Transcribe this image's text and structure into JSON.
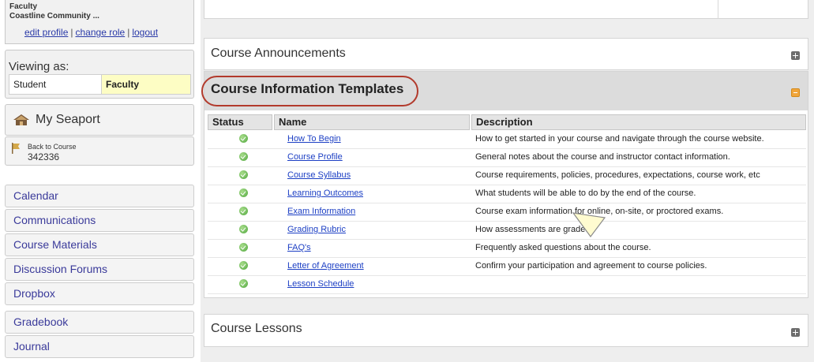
{
  "sidebar": {
    "user": {
      "role": "Faculty",
      "school": "Coastline Community ...",
      "links": [
        "edit profile",
        "change role",
        "logout"
      ],
      "separator": "|"
    },
    "viewing": {
      "label": "Viewing as:",
      "student": "Student",
      "faculty": "Faculty",
      "selected": "Faculty"
    },
    "my_seaport": {
      "label": "My Seaport",
      "icon": "home-icon"
    },
    "back_to_course": {
      "label": "Back to Course",
      "code": "342336",
      "icon": "flag-icon"
    },
    "nav": [
      "Calendar",
      "Communications",
      "Course Materials",
      "Discussion Forums",
      "Dropbox",
      "Gradebook",
      "Journal"
    ]
  },
  "main": {
    "announcements": {
      "title": "Course Announcements",
      "icon": "expand-plus-icon"
    },
    "templates": {
      "title": "Course Information Templates",
      "icon": "collapse-minus-icon",
      "highlight_color": "#b23a2c",
      "columns": {
        "status": "Status",
        "name": "Name",
        "description": "Description"
      },
      "rows": [
        {
          "status": "check-icon",
          "name": "How To Begin",
          "description": "How to get started in your course and navigate through the course website."
        },
        {
          "status": "check-icon",
          "name": "Course Profile",
          "description": "General notes about the course and instructor contact information."
        },
        {
          "status": "check-icon",
          "name": "Course Syllabus",
          "description": "Course requirements, policies, procedures, expectations, course work, etc"
        },
        {
          "status": "check-icon",
          "name": "Learning Outcomes",
          "description": "What students will be able to do by the end of the course."
        },
        {
          "status": "check-icon",
          "name": "Exam Information",
          "description": "Course exam information for online, on-site, or proctored exams."
        },
        {
          "status": "check-icon",
          "name": "Grading Rubric",
          "description": "How assessments are graded."
        },
        {
          "status": "check-icon",
          "name": "FAQ's",
          "description": "Frequently asked questions about the course."
        },
        {
          "status": "check-icon",
          "name": "Letter of Agreement",
          "description": "Confirm your participation and agreement to course policies."
        },
        {
          "status": "check-icon",
          "name": "Lesson Schedule",
          "description": ""
        }
      ]
    },
    "lessons": {
      "title": "Course Lessons",
      "icon": "expand-plus-icon"
    }
  },
  "colors": {
    "status_ok": "#52a840",
    "link": "#1c3fc4",
    "nav_text": "#3a3a9a",
    "faculty_highlight": "#fdfdc4",
    "collapse_icon": "#f1a53a"
  }
}
